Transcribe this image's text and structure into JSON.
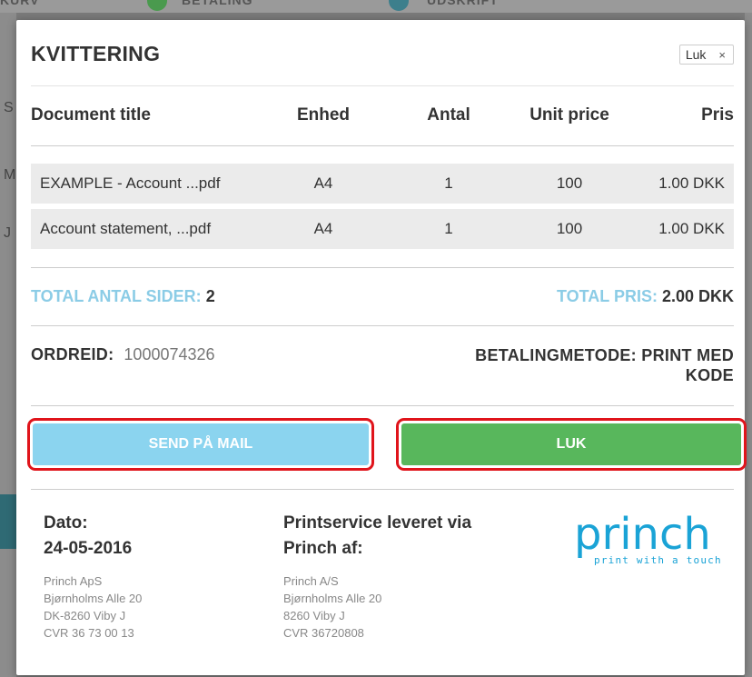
{
  "background": {
    "steps": [
      "KURV",
      "BETALING",
      "UDSKRIFT"
    ],
    "side_chars": [
      "S",
      "M",
      "J"
    ]
  },
  "modal": {
    "title": "KVITTERING",
    "close_label": "Luk",
    "close_icon": "×"
  },
  "table": {
    "headers": [
      "Document title",
      "Enhed",
      "Antal",
      "Unit price",
      "Pris"
    ],
    "rows": [
      {
        "title": "EXAMPLE - Account ...pdf",
        "unit": "A4",
        "qty": "1",
        "unit_price": "100",
        "price": "1.00 DKK"
      },
      {
        "title": "Account statement, ...pdf",
        "unit": "A4",
        "qty": "1",
        "unit_price": "100",
        "price": "1.00 DKK"
      }
    ]
  },
  "totals": {
    "pages_label": "TOTAL ANTAL SIDER:",
    "pages_value": "2",
    "price_label": "TOTAL PRIS:",
    "price_value": "2.00 DKK"
  },
  "order": {
    "id_label": "ORDREID:",
    "id_value": "1000074326",
    "method_label": "BETALINGMETODE:",
    "method_value": "PRINT MED KODE"
  },
  "buttons": {
    "mail_label": "SEND PÅ MAIL",
    "close_label": "LUK"
  },
  "footer": {
    "date_label": "Dato:",
    "date_value": "24-05-2016",
    "company_lines": [
      "Princh ApS",
      "Bjørnholms Alle 20",
      "DK-8260 Viby J",
      "CVR 36 73 00 13"
    ],
    "service_heading_1": "Printservice leveret via",
    "service_heading_2": "Princh af:",
    "service_lines": [
      "Princh A/S",
      "Bjørnholms Alle 20",
      "8260 Viby J",
      "CVR 36720808"
    ]
  },
  "logo": {
    "word": "princh",
    "tagline": "print with a touch",
    "color": "#1aa3d6"
  },
  "colors": {
    "accent_blue": "#8bcce6",
    "button_blue": "#8bd4ef",
    "button_green": "#58b75c",
    "highlight_red": "#e0141b"
  }
}
